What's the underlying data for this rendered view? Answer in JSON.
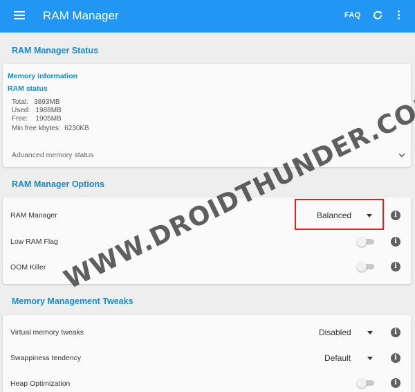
{
  "appbar": {
    "title": "RAM Manager",
    "faq_label": "FAQ",
    "icons": [
      "menu-icon",
      "refresh-icon",
      "more-vert-icon"
    ],
    "color": "#2196f3"
  },
  "status_section": {
    "title": "RAM Manager Status",
    "memory_info_title": "Memory information",
    "ram_status_title": "RAM status",
    "lines": [
      "Total:   3893MB",
      "Used:   1988MB",
      "Free:    1905MB",
      "Min free kbytes:  6230KB"
    ],
    "advanced_label": "Advanced memory status"
  },
  "options_section": {
    "title": "RAM Manager Options",
    "rows": [
      {
        "label": "RAM Manager",
        "control": "dropdown",
        "value": "Balanced"
      },
      {
        "label": "Low RAM Flag",
        "control": "toggle",
        "value": "off"
      },
      {
        "label": "OOM Killer",
        "control": "toggle",
        "value": "off"
      }
    ]
  },
  "tweaks_section": {
    "title": "Memory Management Tweaks",
    "rows": [
      {
        "label": "Virtual memory tweaks",
        "control": "dropdown",
        "value": "Disabled"
      },
      {
        "label": "Swappiness tendency",
        "control": "dropdown",
        "value": "Default"
      },
      {
        "label": "Heap Optimization",
        "control": "toggle",
        "value": "off"
      }
    ]
  },
  "watermark": "WWW.DROIDTHUNDER.COM",
  "accent_color": "#1e88c8",
  "highlight_color": "#e0201c"
}
